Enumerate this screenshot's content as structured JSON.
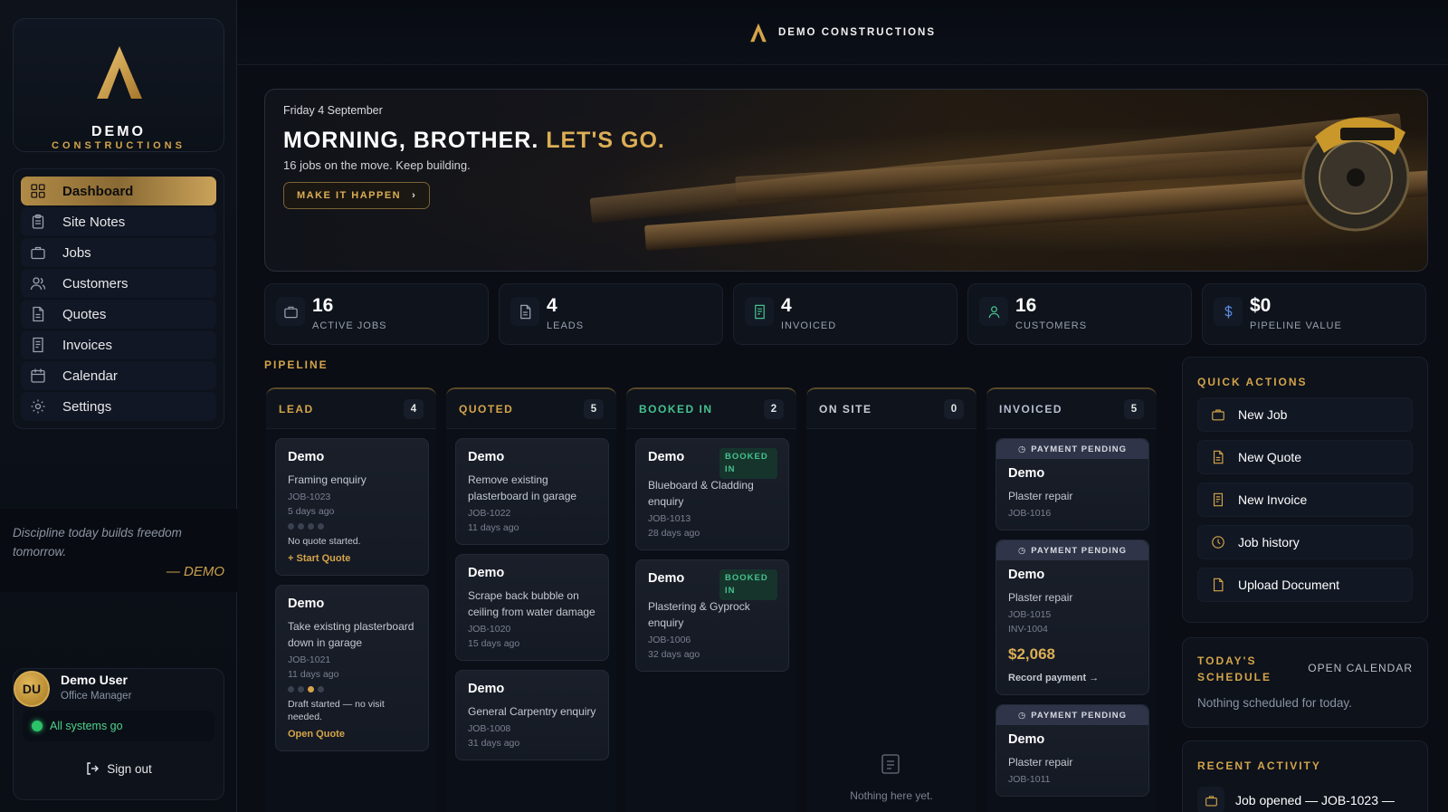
{
  "brand": {
    "name": "DEMO",
    "sub": "CONSTRUCTIONS",
    "topbar": "DEMO CONSTRUCTIONS"
  },
  "nav": [
    {
      "label": "Dashboard",
      "icon": "grid-icon",
      "active": true
    },
    {
      "label": "Site Notes",
      "icon": "clipboard-icon"
    },
    {
      "label": "Jobs",
      "icon": "briefcase-icon"
    },
    {
      "label": "Customers",
      "icon": "users-icon"
    },
    {
      "label": "Quotes",
      "icon": "document-icon"
    },
    {
      "label": "Invoices",
      "icon": "receipt-icon"
    },
    {
      "label": "Calendar",
      "icon": "calendar-icon"
    },
    {
      "label": "Settings",
      "icon": "gear-icon"
    }
  ],
  "quote": {
    "text": "Discipline today builds freedom tomorrow.",
    "author": "— DEMO"
  },
  "user": {
    "initials": "DU",
    "name": "Demo User",
    "role": "Office Manager",
    "status": "All systems go",
    "signout": "Sign out"
  },
  "hero": {
    "date": "Friday 4 September",
    "title": "MORNING, BROTHER.",
    "title_accent": "LET'S GO.",
    "subtitle": "16 jobs on the move. Keep building.",
    "button": "MAKE IT HAPPEN"
  },
  "stats": [
    {
      "value": "16",
      "label": "ACTIVE JOBS",
      "icon": "briefcase-icon"
    },
    {
      "value": "4",
      "label": "LEADS",
      "icon": "document-icon"
    },
    {
      "value": "4",
      "label": "INVOICED",
      "icon": "receipt-icon"
    },
    {
      "value": "16",
      "label": "CUSTOMERS",
      "icon": "user-icon"
    },
    {
      "value": "$0",
      "label": "PIPELINE VALUE",
      "icon": "dollar-icon"
    }
  ],
  "pipeline": {
    "label": "PIPELINE",
    "columns": [
      {
        "title": "LEAD",
        "count": "4",
        "color": "#d4a44a",
        "cards": [
          {
            "title": "Demo",
            "desc": "Framing enquiry",
            "job": "JOB-1023",
            "age": "5 days ago",
            "note": "No quote started.",
            "link": "+ Start Quote"
          },
          {
            "title": "Demo",
            "desc": "Take existing plasterboard down in garage",
            "job": "JOB-1021",
            "age": "11 days ago",
            "note": "Draft started — no visit needed.",
            "link": "Open Quote"
          }
        ]
      },
      {
        "title": "QUOTED",
        "count": "5",
        "color": "#d4a44a",
        "cards": [
          {
            "title": "Demo",
            "desc": "Remove existing plasterboard in garage",
            "job": "JOB-1022",
            "age": "11 days ago"
          },
          {
            "title": "Demo",
            "desc": "Scrape back bubble on ceiling from water damage",
            "job": "JOB-1020",
            "age": "15 days ago"
          },
          {
            "title": "Demo",
            "desc": "General Carpentry enquiry",
            "job": "JOB-1008",
            "age": "31 days ago"
          }
        ]
      },
      {
        "title": "BOOKED IN",
        "count": "2",
        "color": "#45c28e",
        "cards": [
          {
            "title": "Demo",
            "badge": "BOOKED IN",
            "desc": "Blueboard & Cladding enquiry",
            "job": "JOB-1013",
            "age": "28 days ago"
          },
          {
            "title": "Demo",
            "badge": "BOOKED IN",
            "desc": "Plastering & Gyprock enquiry",
            "job": "JOB-1006",
            "age": "32 days ago"
          }
        ]
      },
      {
        "title": "ON SITE",
        "count": "0",
        "color": "#c9ccd4",
        "empty": "Nothing here yet."
      },
      {
        "title": "INVOICED",
        "count": "5",
        "color": "#b7bed0",
        "cards": [
          {
            "banner": "PAYMENT PENDING",
            "title": "Demo",
            "desc": "Plaster repair",
            "job": "JOB-1016"
          },
          {
            "banner": "PAYMENT PENDING",
            "title": "Demo",
            "desc": "Plaster repair",
            "job": "JOB-1015",
            "inv": "INV-1004",
            "amount": "$2,068",
            "record": "Record payment →"
          },
          {
            "banner": "PAYMENT PENDING",
            "title": "Demo",
            "desc": "Plaster repair",
            "job": "JOB-1011"
          }
        ]
      }
    ]
  },
  "quick_actions": {
    "title": "QUICK ACTIONS",
    "items": [
      {
        "label": "New Job",
        "icon": "briefcase-icon"
      },
      {
        "label": "New Quote",
        "icon": "document-icon"
      },
      {
        "label": "New Invoice",
        "icon": "receipt-icon"
      },
      {
        "label": "Job history",
        "icon": "clock-icon"
      },
      {
        "label": "Upload Document",
        "icon": "upload-document-icon"
      }
    ]
  },
  "schedule": {
    "title": "TODAY'S SCHEDULE",
    "link": "OPEN CALENDAR",
    "empty": "Nothing scheduled for today."
  },
  "activity": {
    "title": "RECENT ACTIVITY",
    "items": [
      {
        "text": "Job opened — JOB-1023 —",
        "icon": "briefcase-icon"
      }
    ]
  },
  "colors": {
    "accent": "#d4a44a",
    "background": "#0a0d14",
    "success": "#2cc26a"
  }
}
